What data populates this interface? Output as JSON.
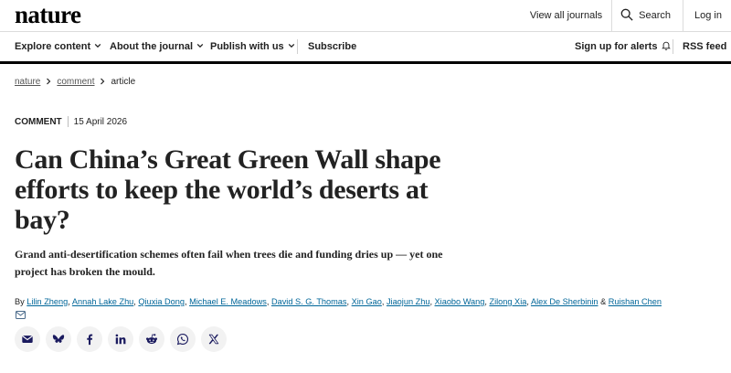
{
  "header": {
    "logo": "nature",
    "view_all_journals": "View all journals",
    "search_label": "Search",
    "login_label": "Log in"
  },
  "nav": {
    "explore": "Explore content",
    "about": "About the journal",
    "publish": "Publish with us",
    "subscribe": "Subscribe",
    "alerts": "Sign up for alerts",
    "rss": "RSS feed"
  },
  "breadcrumb": {
    "items": [
      "nature",
      "comment",
      "article"
    ]
  },
  "article": {
    "type": "COMMENT",
    "date": "15 April 2026",
    "title": "Can China’s Great Green Wall shape efforts to keep the world’s deserts at bay?",
    "standfirst": "Grand anti-desertification schemes often fail when trees die and funding dries up — yet one project has broken the mould.",
    "by_label": "By",
    "authors": [
      "Lilin Zheng",
      "Annah Lake Zhu",
      "Qiuxia Dong",
      "Michael E. Meadows",
      "David S. G. Thomas",
      "Xin Gao",
      "Jiaojun Zhu",
      "Xiaobo Wang",
      "Zilong Xia",
      "Alex De Sherbinin",
      "Ruishan Chen"
    ],
    "authors_and": "&"
  },
  "share": {
    "icons": [
      "email-icon",
      "bluesky-icon",
      "facebook-icon",
      "linkedin-icon",
      "reddit-icon",
      "whatsapp-icon",
      "x-icon"
    ]
  },
  "colors": {
    "link": "#006699",
    "text": "#222222",
    "rule": "#000000",
    "share_bg": "#f2f2f2"
  }
}
